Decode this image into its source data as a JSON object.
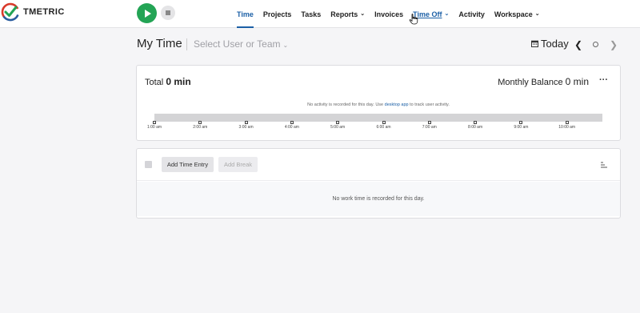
{
  "app": {
    "logo_text": "TMETRIC"
  },
  "nav": {
    "items": [
      {
        "label": "Time",
        "active": true,
        "chevron": false
      },
      {
        "label": "Projects",
        "active": false,
        "chevron": false
      },
      {
        "label": "Tasks",
        "active": false,
        "chevron": false
      },
      {
        "label": "Reports",
        "active": false,
        "chevron": true
      },
      {
        "label": "Invoices",
        "active": false,
        "chevron": false
      },
      {
        "label": "Time Off",
        "active": false,
        "chevron": true,
        "hover": true
      },
      {
        "label": "Activity",
        "active": false,
        "chevron": false
      },
      {
        "label": "Workspace",
        "active": false,
        "chevron": true
      }
    ]
  },
  "header": {
    "title": "My Time",
    "user_select_placeholder": "Select User or Team",
    "today_label": "Today"
  },
  "summary": {
    "total_label": "Total",
    "total_value": "0 min",
    "balance_label": "Monthly Balance",
    "balance_value": "0 min",
    "more_label": "···",
    "no_activity_prefix": "No activity is recorded for this day. Use",
    "no_activity_link": "desktop app",
    "no_activity_suffix": "to track user activity."
  },
  "timeline": {
    "ticks": [
      "1:00 am",
      "2:00 am",
      "3:00 am",
      "4:00 am",
      "5:00 am",
      "6:00 am",
      "7:00 am",
      "8:00 am",
      "9:00 am",
      "10:00 am"
    ]
  },
  "entries": {
    "add_entry_label": "Add Time Entry",
    "add_break_label": "Add Break",
    "empty_message": "No work time is recorded for this day."
  },
  "colors": {
    "accent": "#1b5fa6",
    "play_green": "#23a455"
  }
}
